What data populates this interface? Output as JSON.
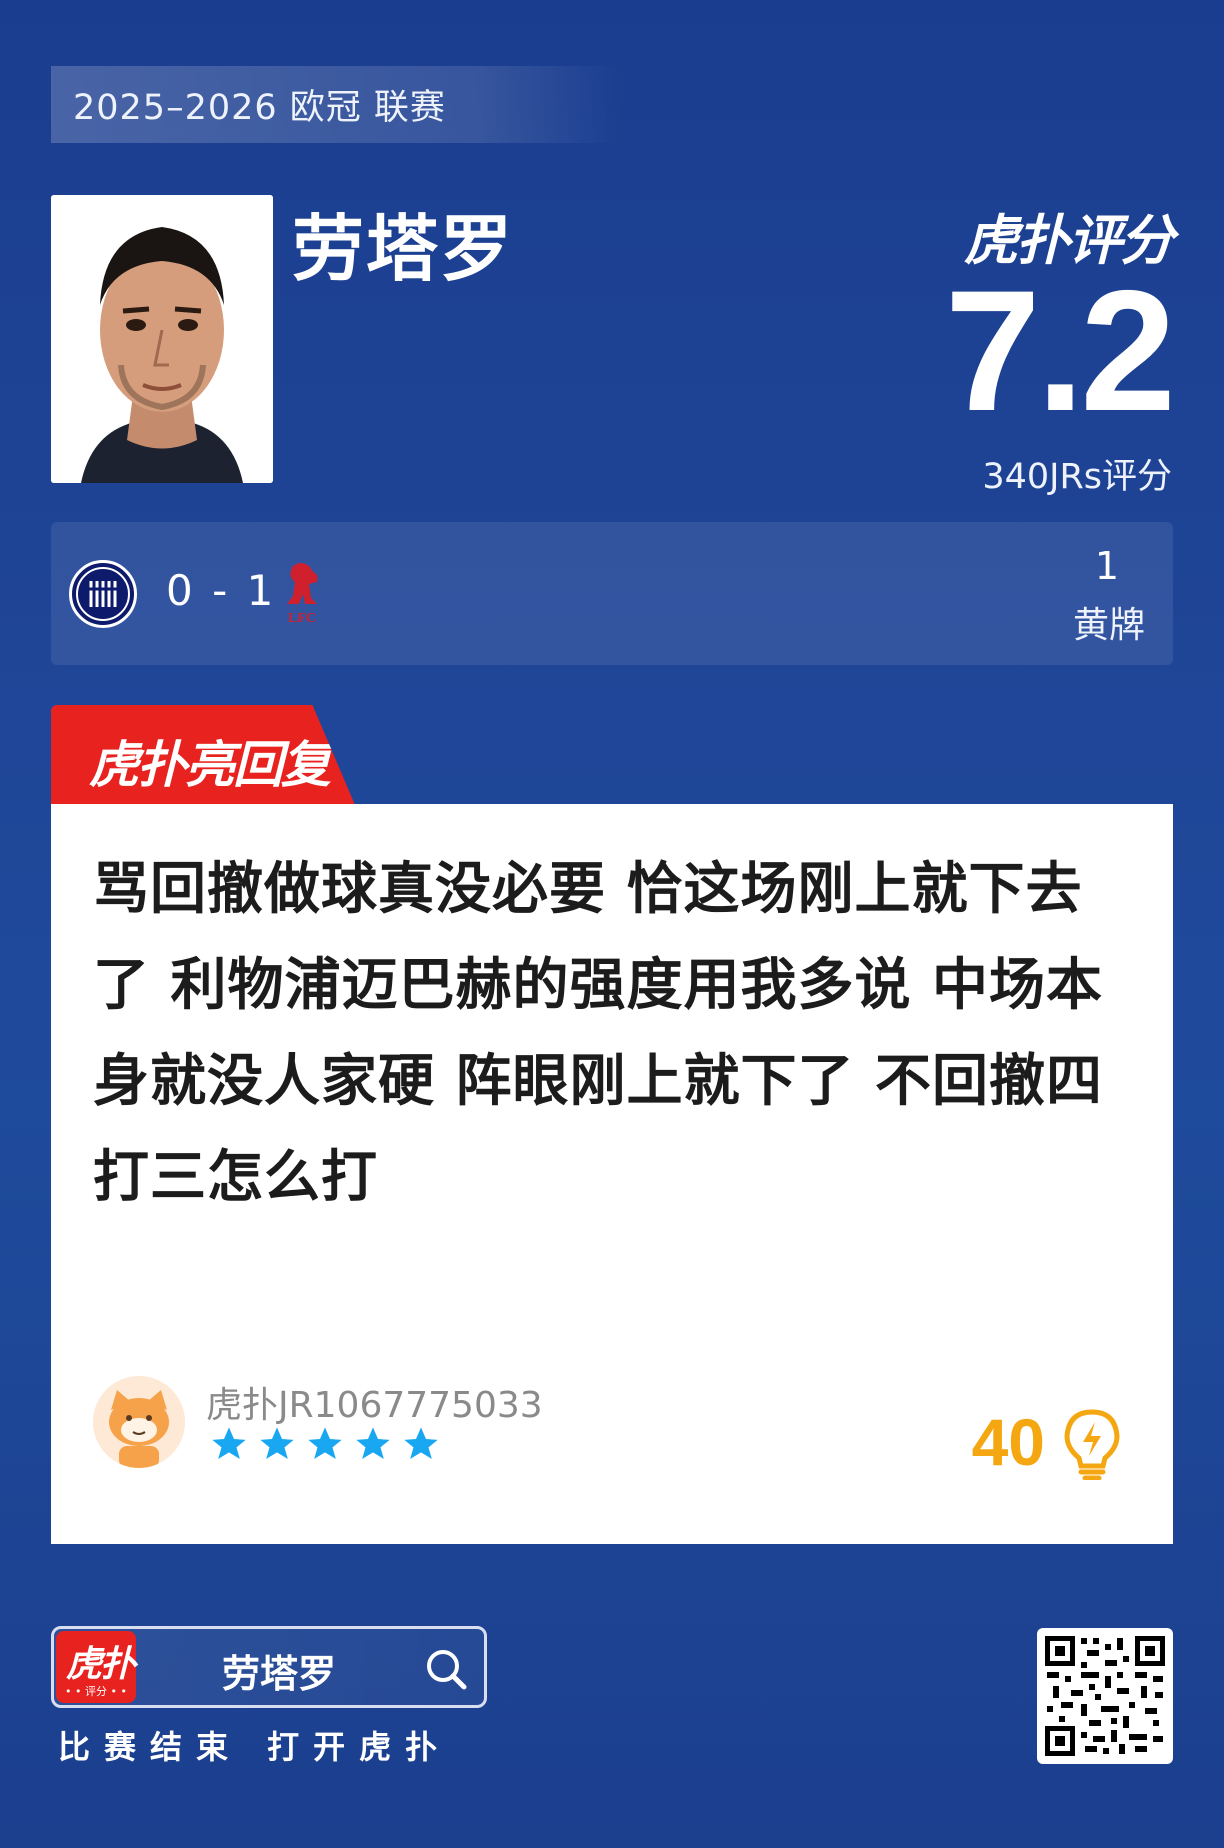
{
  "header": {
    "season_label": "2025–2026 欧冠 联赛",
    "player_name": "劳塔罗",
    "brand": "虎扑评分",
    "score": "7.2",
    "rating_count": "340JRs评分"
  },
  "match": {
    "score": "0 - 1",
    "home_team_icon": "inter-milan-crest-icon",
    "away_team_icon": "liverpool-crest-icon",
    "stat_value": "1",
    "stat_label": "黄牌"
  },
  "reply": {
    "tag": "虎扑亮回复",
    "comment": "骂回撤做球真没必要 恰这场刚上就下去了 利物浦迈巴赫的强度用我多说 中场本身就没人家硬 阵眼刚上就下了 不回撤四打三怎么打",
    "username": "虎扑JR1067775033",
    "stars": 5,
    "likes": "40",
    "colors": {
      "likes": "#f4a711",
      "stars": "#1aa7f2",
      "tag": "#e8231f"
    }
  },
  "footer": {
    "app_icon_main": "虎扑",
    "app_icon_sub": "• • 评分 • •",
    "search_query": "劳塔罗",
    "instruction": "比赛结束 打开虎扑",
    "qr_icon": "qr-code-icon"
  }
}
